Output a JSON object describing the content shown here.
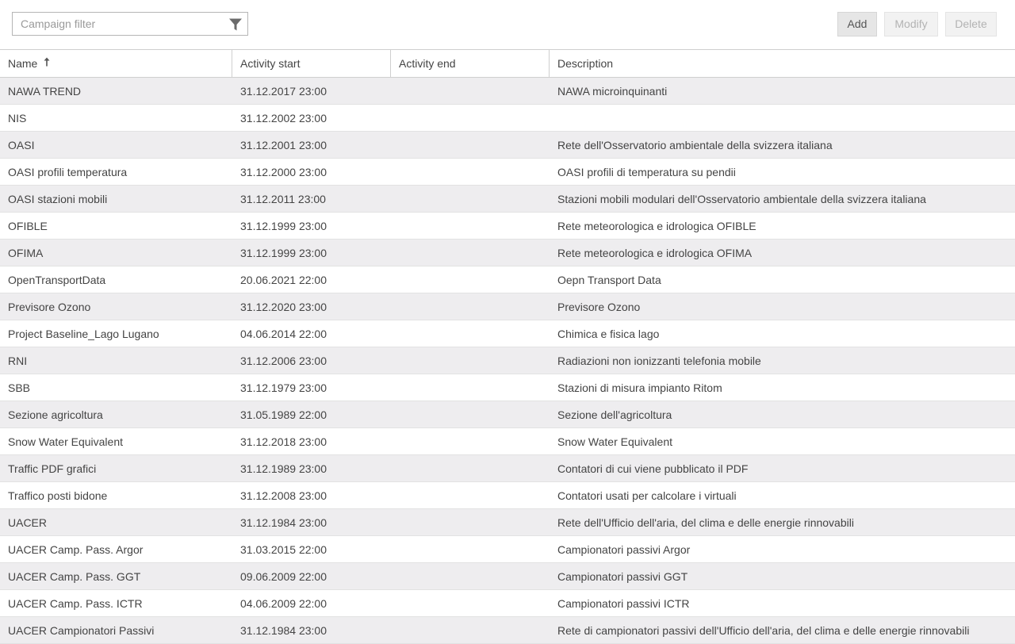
{
  "toolbar": {
    "filter_placeholder": "Campaign filter",
    "filter_icon": "funnel-icon",
    "add_label": "Add",
    "modify_label": "Modify",
    "delete_label": "Delete"
  },
  "table": {
    "columns": [
      "Name",
      "Activity start",
      "Activity end",
      "Description"
    ],
    "sort_column": "Name",
    "sort_direction": "ascending",
    "rows": [
      [
        "NAWA TREND",
        "31.12.2017 23:00",
        "",
        "NAWA microinquinanti"
      ],
      [
        "NIS",
        "31.12.2002 23:00",
        "",
        ""
      ],
      [
        "OASI",
        "31.12.2001 23:00",
        "",
        "Rete dell'Osservatorio ambientale della svizzera italiana"
      ],
      [
        "OASI profili temperatura",
        "31.12.2000 23:00",
        "",
        "OASI profili di temperatura su pendii"
      ],
      [
        "OASI stazioni mobili",
        "31.12.2011 23:00",
        "",
        "Stazioni mobili modulari dell'Osservatorio ambientale della svizzera italiana"
      ],
      [
        "OFIBLE",
        "31.12.1999 23:00",
        "",
        "Rete meteorologica e idrologica OFIBLE"
      ],
      [
        "OFIMA",
        "31.12.1999 23:00",
        "",
        "Rete meteorologica e idrologica OFIMA"
      ],
      [
        "OpenTransportData",
        "20.06.2021 22:00",
        "",
        "Oepn Transport Data"
      ],
      [
        "Previsore Ozono",
        "31.12.2020 23:00",
        "",
        "Previsore Ozono"
      ],
      [
        "Project Baseline_Lago Lugano",
        "04.06.2014 22:00",
        "",
        "Chimica e fisica lago"
      ],
      [
        "RNI",
        "31.12.2006 23:00",
        "",
        "Radiazioni non ionizzanti telefonia mobile"
      ],
      [
        "SBB",
        "31.12.1979 23:00",
        "",
        "Stazioni di misura impianto Ritom"
      ],
      [
        "Sezione agricoltura",
        "31.05.1989 22:00",
        "",
        "Sezione dell'agricoltura"
      ],
      [
        "Snow Water Equivalent",
        "31.12.2018 23:00",
        "",
        "Snow Water Equivalent"
      ],
      [
        "Traffic PDF grafici",
        "31.12.1989 23:00",
        "",
        "Contatori di cui viene pubblicato il PDF"
      ],
      [
        "Traffico posti bidone",
        "31.12.2008 23:00",
        "",
        "Contatori usati per calcolare i virtuali"
      ],
      [
        "UACER",
        "31.12.1984 23:00",
        "",
        "Rete dell'Ufficio dell'aria, del clima e delle energie rinnovabili"
      ],
      [
        "UACER Camp. Pass. Argor",
        "31.03.2015 22:00",
        "",
        "Campionatori passivi Argor"
      ],
      [
        "UACER Camp. Pass. GGT",
        "09.06.2009 22:00",
        "",
        "Campionatori passivi GGT"
      ],
      [
        "UACER Camp. Pass. ICTR",
        "04.06.2009 22:00",
        "",
        "Campionatori passivi ICTR"
      ],
      [
        "UACER Campionatori Passivi",
        "31.12.1984 23:00",
        "",
        "Rete di campionatori passivi dell'Ufficio dell'aria, del clima e delle energie rinnovabili"
      ]
    ]
  }
}
